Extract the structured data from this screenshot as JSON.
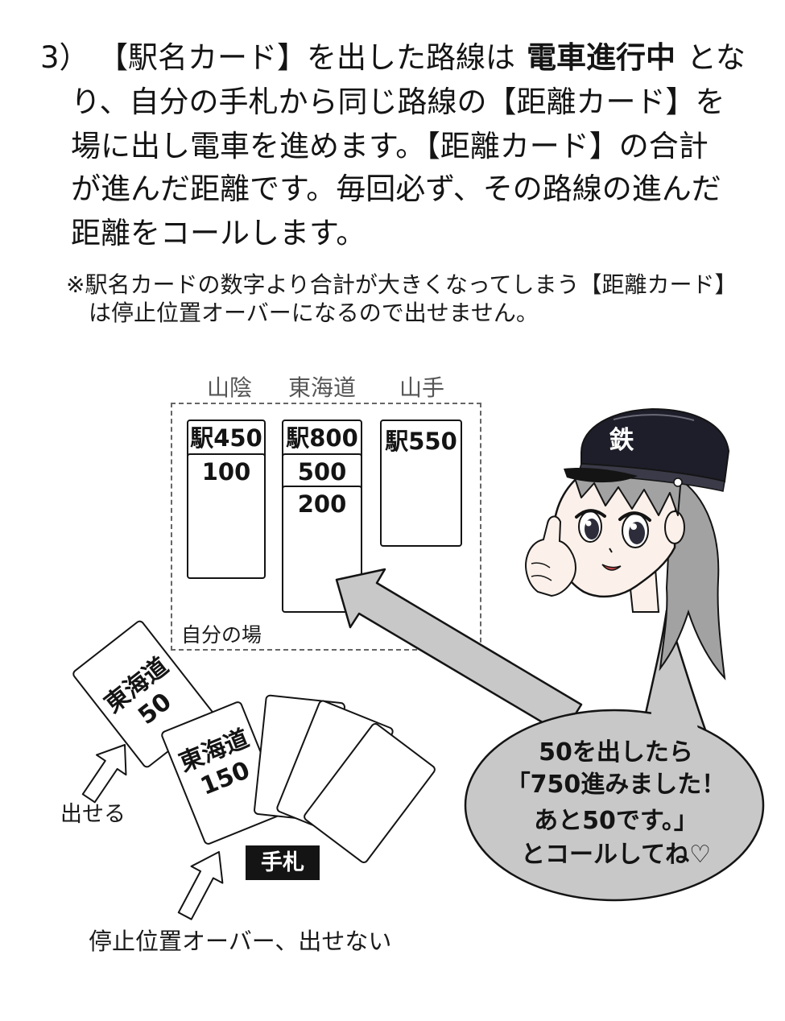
{
  "rule": {
    "number": "3）",
    "line1": {
      "before": "【駅名カード】を出した路線は",
      "emphasis": "電車進行中",
      "after": "とな"
    },
    "lines": [
      "り、自分の手札から同じ路線の【距離カード】を",
      "場に出し電車を進めます。【距離カード】の合計",
      "が進んだ距離です。毎回必ず、その路線の進んだ",
      "距離をコールします。"
    ]
  },
  "note": {
    "lines": [
      "※駅名カードの数字より合計が大きくなってしまう【距離カード】",
      "は停止位置オーバーになるので出せません。"
    ]
  },
  "board": {
    "area_label": "自分の場",
    "columns": [
      {
        "line": "山陰",
        "station_card": "駅450",
        "distance_cards": [
          "100"
        ]
      },
      {
        "line": "東海道",
        "station_card": "駅800",
        "distance_cards": [
          "500",
          "200"
        ]
      },
      {
        "line": "山手",
        "station_card": "駅550",
        "distance_cards": []
      }
    ]
  },
  "hand": {
    "label": "手札",
    "cards": [
      {
        "line": "東海道",
        "value": "50",
        "caption": "出せる"
      },
      {
        "line": "東海道",
        "value": "150",
        "caption": "停止位置オーバー、出せない"
      }
    ]
  },
  "character": {
    "hat_emblem": "鉄"
  },
  "speech_bubble": {
    "lines": [
      "50を出したら",
      "「750進みました！",
      "あと50です。」",
      "とコールしてね♡"
    ]
  },
  "colors": {
    "ink": "#141414",
    "bubble_fill": "#c8c8c8",
    "arrow_fill": "#c8c8c8",
    "hat": "#1e1e2a",
    "hair": "#a2a2a2",
    "hand_label_bg": "#141414"
  }
}
